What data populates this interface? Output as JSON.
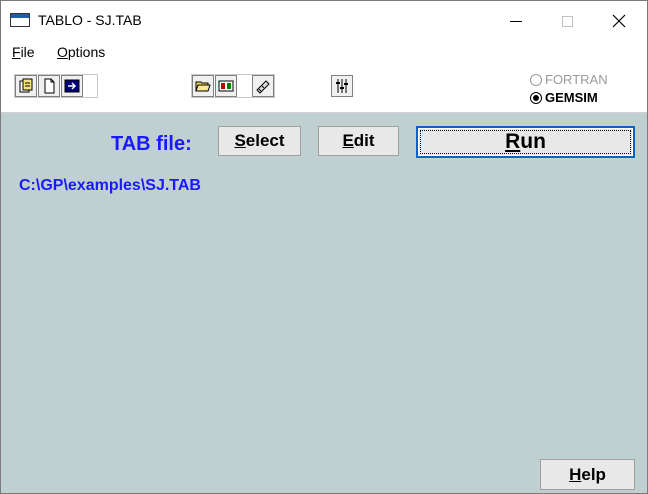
{
  "window": {
    "title": "TABLO - SJ.TAB",
    "controls": [
      "minimize",
      "maximize",
      "close"
    ]
  },
  "menu": {
    "file": {
      "accel": "F",
      "rest": "ile"
    },
    "options": {
      "accel": "O",
      "rest": "ptions"
    }
  },
  "toolbar": {
    "icons": [
      "new-project-icon",
      "new-document-icon",
      "run-icon",
      "open-folder-icon",
      "view-icon",
      "tools-icon",
      "settings-sliders-icon"
    ],
    "mode": {
      "fortran_label": "FORTRAN",
      "gemsim_label": "GEMSIM",
      "selected": "GEMSIM"
    }
  },
  "main": {
    "tab_file_label": "TAB file:",
    "select": {
      "accel": "S",
      "rest": "elect"
    },
    "edit": {
      "accel": "E",
      "rest": "dit"
    },
    "run": {
      "accel": "R",
      "rest": "un"
    },
    "file_path": "C:\\GP\\examples\\SJ.TAB",
    "help": {
      "accel": "H",
      "rest": "elp"
    }
  },
  "colors": {
    "client_bg": "#c0d0d0",
    "accent_text": "#1a1aff",
    "focus_border": "#0a64c8"
  }
}
